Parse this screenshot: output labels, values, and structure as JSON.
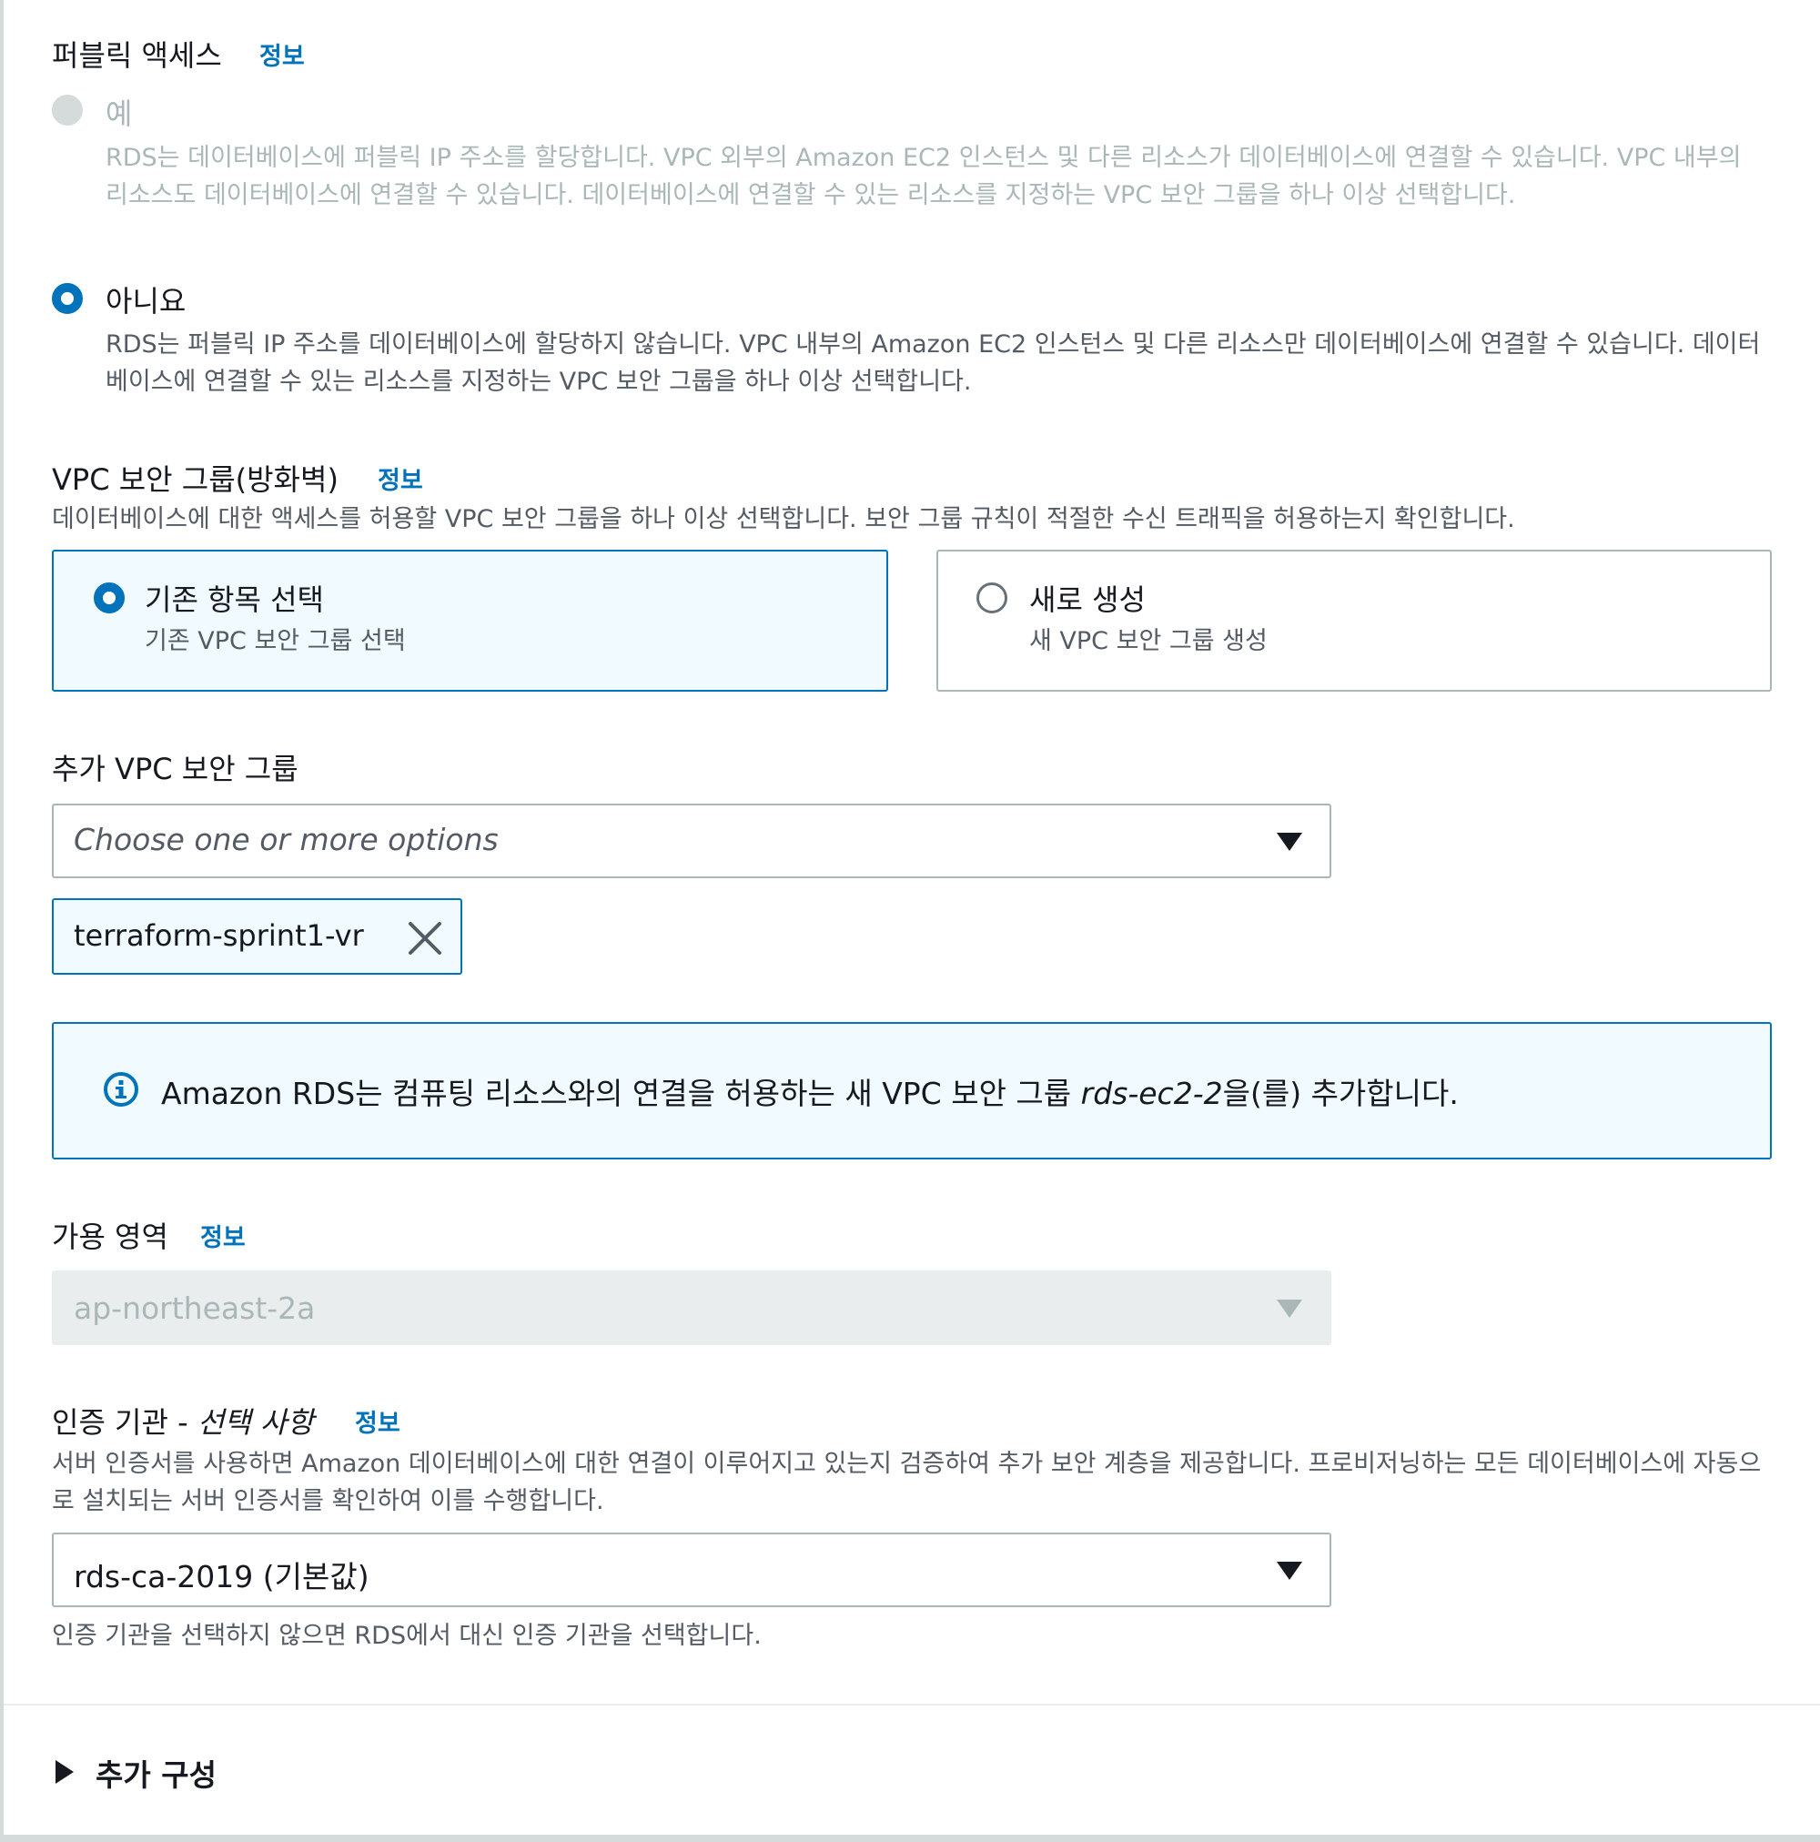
{
  "public_access": {
    "title": "퍼블릭 액세스",
    "info": "정보",
    "options": [
      {
        "label": "예",
        "description": "RDS는 데이터베이스에 퍼블릭 IP 주소를 할당합니다. VPC 외부의 Amazon EC2 인스턴스 및 다른 리소스가 데이터베이스에 연결할 수 있습니다. VPC 내부의 리소스도 데이터베이스에 연결할 수 있습니다. 데이터베이스에 연결할 수 있는 리소스를 지정하는 VPC 보안 그룹을 하나 이상 선택합니다.",
        "selected": false,
        "disabled": true
      },
      {
        "label": "아니요",
        "description": "RDS는 퍼블릭 IP 주소를 데이터베이스에 할당하지 않습니다. VPC 내부의 Amazon EC2 인스턴스 및 다른 리소스만 데이터베이스에 연결할 수 있습니다. 데이터베이스에 연결할 수 있는 리소스를 지정하는 VPC 보안 그룹을 하나 이상 선택합니다.",
        "selected": true,
        "disabled": false
      }
    ]
  },
  "vpc_security_group": {
    "title": "VPC 보안 그룹(방화벽)",
    "info": "정보",
    "description": "데이터베이스에 대한 액세스를 허용할 VPC 보안 그룹을 하나 이상 선택합니다. 보안 그룹 규칙이 적절한 수신 트래픽을 허용하는지 확인합니다.",
    "tiles": [
      {
        "title": "기존 항목 선택",
        "subtitle": "기존 VPC 보안 그룹 선택",
        "selected": true
      },
      {
        "title": "새로 생성",
        "subtitle": "새 VPC 보안 그룹 생성",
        "selected": false
      }
    ]
  },
  "additional_sg": {
    "title": "추가 VPC 보안 그룹",
    "placeholder": "Choose one or more options",
    "tokens": [
      "terraform-sprint1-vr"
    ]
  },
  "alert": {
    "text_before": "Amazon RDS는 컴퓨팅 리소스와의 연결을 허용하는 새 VPC 보안 그룹 ",
    "text_italic": "rds-ec2-2",
    "text_after": "을(를) 추가합니다."
  },
  "availability_zone": {
    "title": "가용 영역",
    "info": "정보",
    "value": "ap-northeast-2a",
    "disabled": true
  },
  "certificate_authority": {
    "title": "인증 기관 - ",
    "title_italic": "선택 사항",
    "info": "정보",
    "description": "서버 인증서를 사용하면 Amazon 데이터베이스에 대한 연결이 이루어지고 있는지 검증하여 추가 보안 계층을 제공합니다. 프로비저닝하는 모든 데이터베이스에 자동으로 설치되는 서버 인증서를 확인하여 이를 수행합니다.",
    "value": "rds-ca-2019 (기본값)",
    "hint": "인증 기관을 선택하지 않으면 RDS에서 대신 인증 기관을 선택합니다."
  },
  "additional_config": {
    "label": "추가 구성"
  },
  "colors": {
    "accent": "#0073bb",
    "selected_bg": "#f1faff",
    "text": "#16191f",
    "secondary": "#545b64",
    "disabled": "#aab7b8"
  }
}
